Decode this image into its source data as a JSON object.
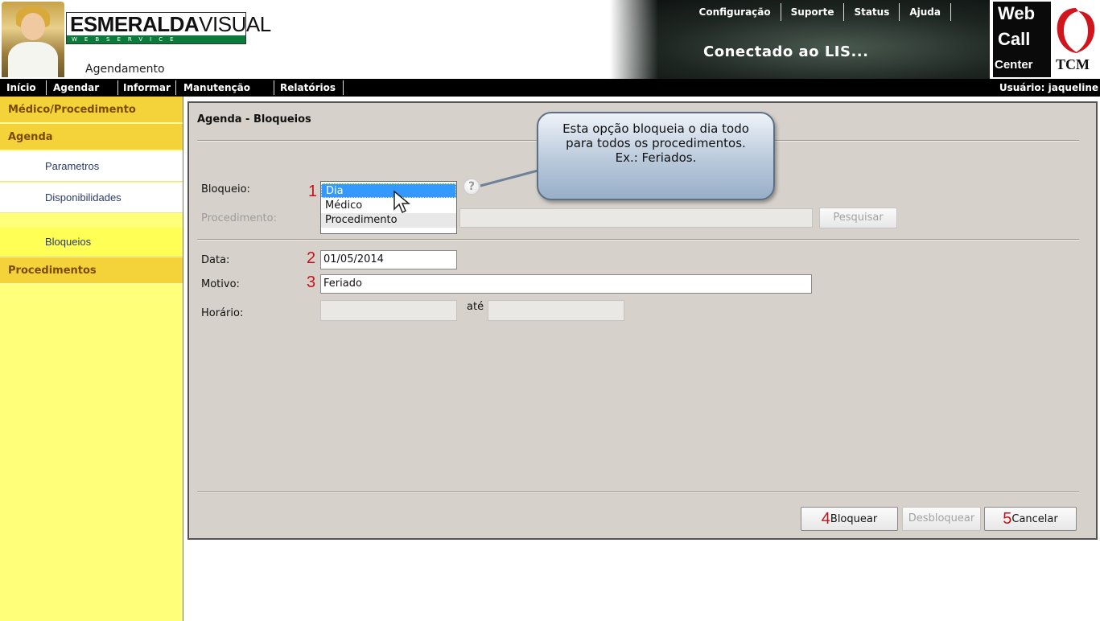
{
  "header": {
    "brand_bold": "ESMERALDA",
    "brand_light": "VISUAL",
    "brand_strip": "WEBSERVICE",
    "app_subtitle": "Agendamento",
    "top_menu": [
      "Configuração",
      "Suporte",
      "Status",
      "Ajuda"
    ],
    "status_text": "Conectado ao LIS...",
    "callcenter": {
      "line1": "Web",
      "line2": "Call",
      "line3": "Center",
      "tcm": "TCM"
    }
  },
  "nav": {
    "items": [
      "Início",
      "Agendar",
      "Informar",
      "Manutenção",
      "Relatórios"
    ],
    "user_label": "Usuário: jaqueline"
  },
  "sidebar": {
    "sections": [
      {
        "label": "Médico/Procedimento"
      },
      {
        "label": "Agenda"
      }
    ],
    "items": [
      {
        "label": "Parametros"
      },
      {
        "label": "Disponibilidades"
      },
      {
        "label": "Bloqueios",
        "active": true
      }
    ],
    "last_section": {
      "label": "Procedimentos"
    }
  },
  "panel": {
    "title": "Agenda - Bloqueios",
    "bloqueio_label": "Bloqueio:",
    "bloqueio_options": [
      "Dia",
      "Médico",
      "Procedimento"
    ],
    "bloqueio_selected": "Dia",
    "procedimento_label": "Procedimento:",
    "pesquisar_label": "Pesquisar",
    "data_label": "Data:",
    "data_value": "01/05/2014",
    "motivo_label": "Motivo:",
    "motivo_value": "Feriado",
    "horario_label": "Horário:",
    "ate_label": "até",
    "tooltip": "Esta opção bloqueia o dia todo para todos os procedimentos. Ex.: Feriados.",
    "help_icon_glyph": "?",
    "markers": [
      "1",
      "2",
      "3",
      "4",
      "5"
    ],
    "buttons": {
      "bloquear": "Bloquear",
      "desbloquear": "Desbloquear",
      "cancelar": "Cancelar"
    }
  },
  "colors": {
    "sidebar_bg": "#ffff7a",
    "section_bg": "#f4d23a",
    "panel_bg": "#d6d1cb",
    "marker_red": "#c8101a",
    "selected_blue": "#3399ff"
  }
}
